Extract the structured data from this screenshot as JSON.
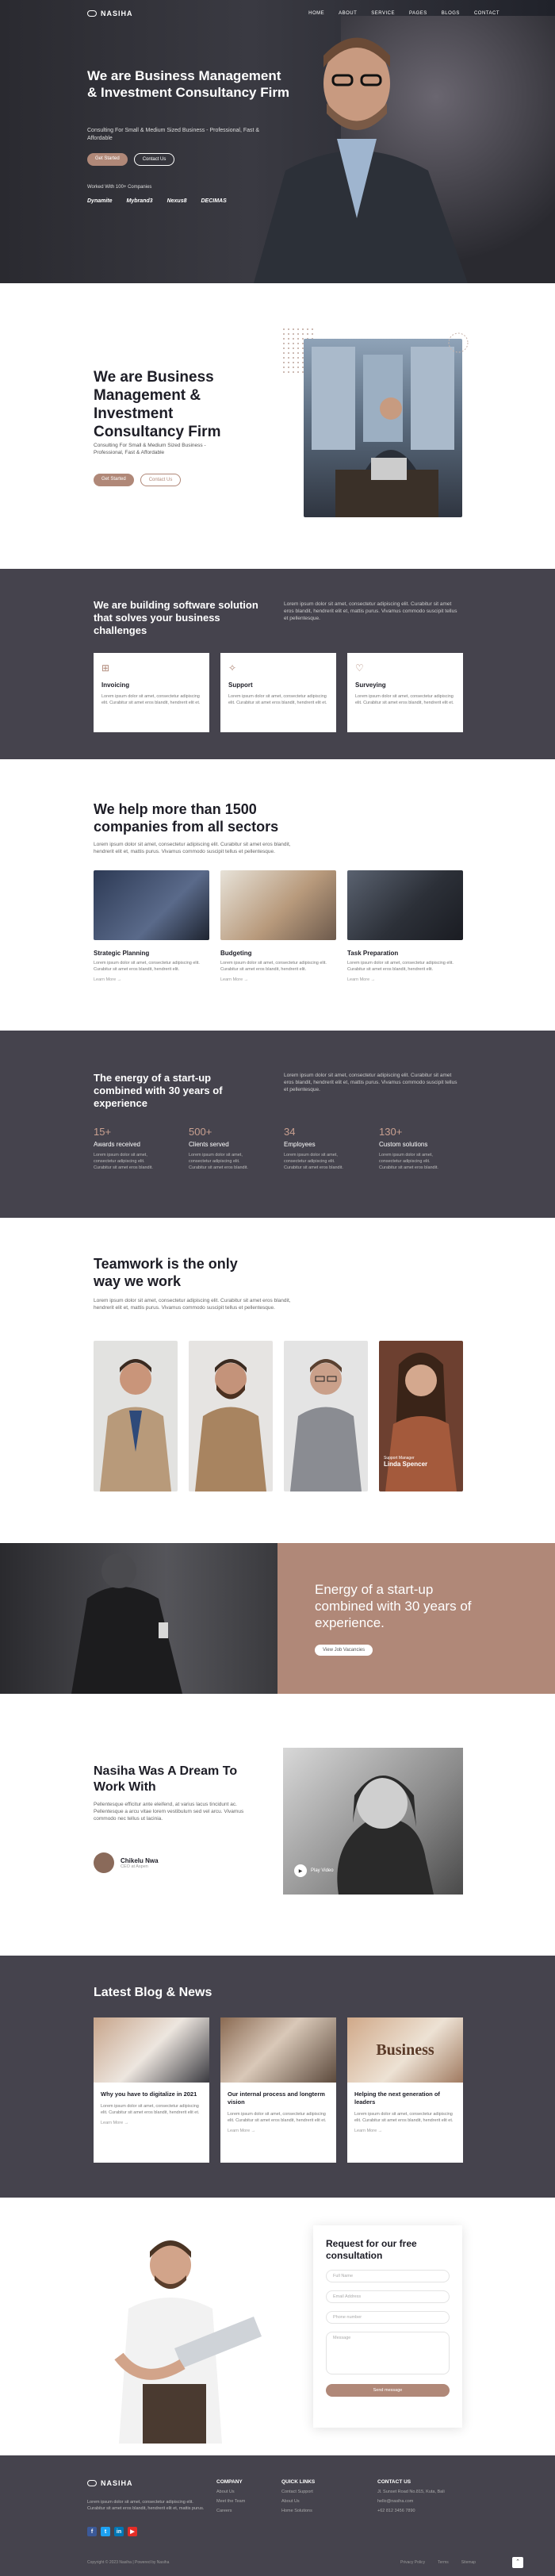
{
  "brand": {
    "name": "NASIHA",
    "accent": "#b08878",
    "dark": "#45434d"
  },
  "nav": {
    "items": [
      "HOME",
      "ABOUT",
      "SERVICE",
      "PAGES",
      "BLOGS",
      "CONTACT"
    ]
  },
  "hero": {
    "title": "We are Business Management & Investment Consultancy Firm",
    "subtitle": "Consulting For Small & Medium Sized Business - Professional, Fast & Affordable",
    "primary_button": "Get Started",
    "secondary_button": "Contact Us",
    "trusted": "Worked With 100+ Companies",
    "logos": [
      "Dynamite",
      "Mybrand3",
      "Nexus8",
      "DECIMAS"
    ]
  },
  "about": {
    "title": "We are Business Management & Investment Consultancy Firm",
    "subtitle": "Consulting For Small & Medium Sized Business - Professional, Fast & Affordable",
    "primary_button": "Get Started",
    "secondary_button": "Contact Us"
  },
  "services": {
    "title": "We are building software solution that solves your business challenges",
    "text": "Lorem ipsum dolor sit amet, consectetur adipiscing elit. Curabitur sit amet eros blandit, hendrerit elit et, mattis purus. Vivamus commodo suscipit tellus et pellentesque.",
    "cards": [
      {
        "title": "Invoicing",
        "text": "Lorem ipsum dolor sit amet, consectetur adipiscing elit. Curabitur sit amet eros blandit, hendrerit elit et."
      },
      {
        "title": "Support",
        "text": "Lorem ipsum dolor sit amet, consectetur adipiscing elit. Curabitur sit amet eros blandit, hendrerit elit et."
      },
      {
        "title": "Surveying",
        "text": "Lorem ipsum dolor sit amet, consectetur adipiscing elit. Curabitur sit amet eros blandit, hendrerit elit et."
      }
    ]
  },
  "sectors": {
    "title": "We help more than 1500 companies from all sectors",
    "text": "Lorem ipsum dolor sit amet, consectetur adipiscing elit. Curabitur sit amet eros blandit, hendrerit elit et, mattis purus. Vivamus commodo suscipit tellus et pellentesque.",
    "learn_more": "Learn More →",
    "cards": [
      {
        "title": "Strategic Planning",
        "text": "Lorem ipsum dolor sit amet, consectetur adipiscing elit. Curabitur sit amet eros blandit, hendrerit elit."
      },
      {
        "title": "Budgeting",
        "text": "Lorem ipsum dolor sit amet, consectetur adipiscing elit. Curabitur sit amet eros blandit, hendrerit elit."
      },
      {
        "title": "Task Preparation",
        "text": "Lorem ipsum dolor sit amet, consectetur adipiscing elit. Curabitur sit amet eros blandit, hendrerit elit."
      }
    ]
  },
  "energy": {
    "title": "The energy of a start-up combined with 30 years of experience",
    "text": "Lorem ipsum dolor sit amet, consectetur adipiscing elit. Curabitur sit amet eros blandit, hendrerit elit et, mattis purus. Vivamus commodo suscipit tellus et pellentesque.",
    "stats": [
      {
        "num": "15+",
        "label": "Awards received",
        "text": "Lorem ipsum dolor sit amet, consectetur adipiscing elit. Curabitur sit amet eros blandit."
      },
      {
        "num": "500+",
        "label": "Clients served",
        "text": "Lorem ipsum dolor sit amet, consectetur adipiscing elit. Curabitur sit amet eros blandit."
      },
      {
        "num": "34",
        "label": "Employees",
        "text": "Lorem ipsum dolor sit amet, consectetur adipiscing elit. Curabitur sit amet eros blandit."
      },
      {
        "num": "130+",
        "label": "Custom solutions",
        "text": "Lorem ipsum dolor sit amet, consectetur adipiscing elit. Curabitur sit amet eros blandit."
      }
    ]
  },
  "team": {
    "title": "Teamwork is the only way we work",
    "text": "Lorem ipsum dolor sit amet, consectetur adipiscing elit. Curabitur sit amet eros blandit, hendrerit elit et, mattis purus. Vivamus commodo suscipit tellus et pellentesque.",
    "featured_role": "Support Manager",
    "featured_name": "Linda Spencer"
  },
  "banner": {
    "title": "Energy of a start-up combined with 30 years of experience.",
    "button": "View Job Vacancies"
  },
  "dream": {
    "title": "Nasiha Was A Dream To Work With",
    "text": "Pellentesque efficitur ante eleifend, at varius lacus tincidunt ac. Pellentesque a arcu vitae lorem vestibulum sed vel arcu. Vivamus commodo nec tellus ut lacinia.",
    "author_name": "Chikelu Nwa",
    "author_role": "CEO at Aspen",
    "play_label": "Play Video"
  },
  "blog": {
    "title": "Latest Blog & News",
    "learn_more": "Learn More →",
    "posts": [
      {
        "title": "Why you have to digitalize in 2021",
        "text": "Lorem ipsum dolor sit amet, consectetur adipiscing elit. Curabitur sit amet eros blandit, hendrerit elit et."
      },
      {
        "title": "Our internal process and longterm vision",
        "text": "Lorem ipsum dolor sit amet, consectetur adipiscing elit. Curabitur sit amet eros blandit, hendrerit elit et."
      },
      {
        "title": "Helping the next generation of leaders",
        "text": "Lorem ipsum dolor sit amet, consectetur adipiscing elit. Curabitur sit amet eros blandit, hendrerit elit et."
      }
    ],
    "sign_text": "Business"
  },
  "contact": {
    "title": "Request for our free consultation",
    "fields": [
      "Full Name",
      "Email Address",
      "Phone number",
      "Message"
    ],
    "submit": "Send message"
  },
  "footer": {
    "text": "Lorem ipsum dolor sit amet, consectetur adipiscing elit. Curabitur sit amet eros blandit, hendrerit elit et, mattis purus.",
    "socials": [
      "f",
      "t",
      "in",
      "▶"
    ],
    "company": {
      "title": "COMPANY",
      "items": [
        "About Us",
        "Meet the Team",
        "Careers"
      ]
    },
    "quick": {
      "title": "QUICK LINKS",
      "items": [
        "Contact Support",
        "About Us",
        "Home Solutions"
      ]
    },
    "contact": {
      "title": "CONTACT US",
      "items": [
        "Jl. Sunset Road No.815, Kuta, Bali",
        "hello@nasiha.com",
        "+62 812 3456 7890"
      ]
    },
    "copyright": "Copyright © 2023 Nasiha | Powered by Nasiha",
    "bottom_links": [
      "Privacy Policy",
      "Terms",
      "Sitemap"
    ]
  }
}
